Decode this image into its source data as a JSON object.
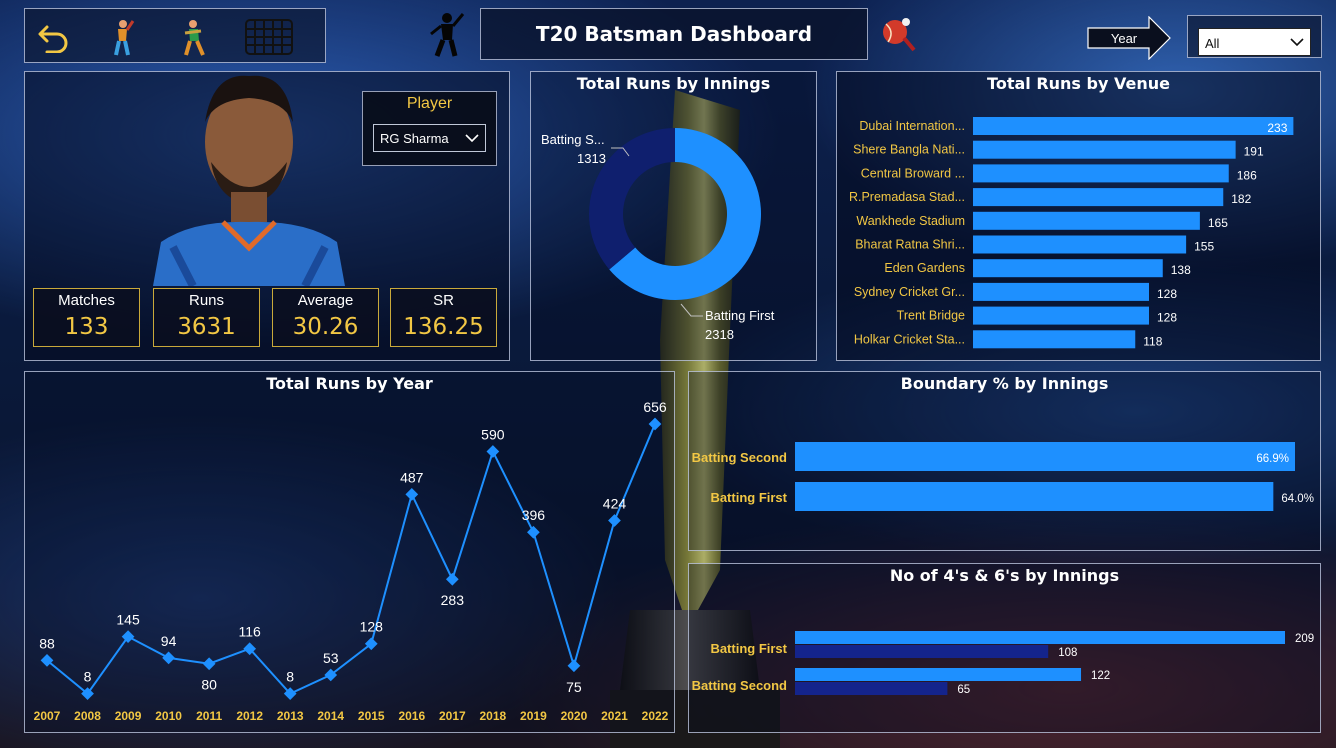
{
  "header": {
    "title": "T20 Batsman Dashboard",
    "year_filter_label": "Year",
    "year_filter_value": "All",
    "icons": [
      "back-arrow-icon",
      "batsman-icon",
      "batsman-pose-icon",
      "calendar-grid-icon",
      "cricket-player-silhouette-icon",
      "cricket-ball-logo-icon"
    ]
  },
  "player": {
    "label": "Player",
    "selected": "RG Sharma"
  },
  "kpis": [
    {
      "label": "Matches",
      "value": "133"
    },
    {
      "label": "Runs",
      "value": "3631"
    },
    {
      "label": "Average",
      "value": "30.26"
    },
    {
      "label": "SR",
      "value": "136.25"
    }
  ],
  "colors": {
    "accent": "#1e90ff",
    "dark_series": "#14248c",
    "gold": "#f2c744",
    "donut_second": "#0f1f6e"
  },
  "chart_data": [
    {
      "type": "pie",
      "title": "Total Runs by Innings",
      "categories": [
        "Batting First",
        "Batting S..."
      ],
      "values": [
        2318,
        1313
      ]
    },
    {
      "type": "bar",
      "title": "Total Runs by Venue",
      "categories": [
        "Dubai Internation...",
        "Shere Bangla Nati...",
        "Central Broward ...",
        "R.Premadasa Stad...",
        "Wankhede Stadium",
        "Bharat Ratna Shri...",
        "Eden Gardens",
        "Sydney Cricket Gr...",
        "Trent Bridge",
        "Holkar Cricket Sta..."
      ],
      "values": [
        233,
        191,
        186,
        182,
        165,
        155,
        138,
        128,
        128,
        118
      ]
    },
    {
      "type": "line",
      "title": "Total Runs by Year",
      "x": [
        "2007",
        "2008",
        "2009",
        "2010",
        "2011",
        "2012",
        "2013",
        "2014",
        "2015",
        "2016",
        "2017",
        "2018",
        "2019",
        "2020",
        "2021",
        "2022"
      ],
      "values": [
        88,
        8,
        145,
        94,
        80,
        116,
        8,
        53,
        128,
        487,
        283,
        590,
        396,
        75,
        424,
        656
      ]
    },
    {
      "type": "bar",
      "title": "Boundary % by Innings",
      "categories": [
        "Batting Second",
        "Batting First"
      ],
      "values": [
        66.9,
        64.0
      ],
      "value_labels": [
        "66.9%",
        "64.0%"
      ]
    },
    {
      "type": "bar",
      "title": "No of 4's & 6's by Innings",
      "categories": [
        "Batting First",
        "Batting Second"
      ],
      "series": [
        {
          "values": [
            209,
            122
          ]
        },
        {
          "values": [
            108,
            65
          ]
        }
      ]
    }
  ]
}
